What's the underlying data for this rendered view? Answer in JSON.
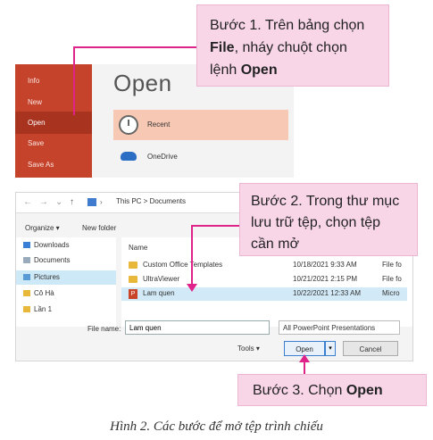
{
  "backstage": {
    "menu": [
      "Info",
      "New",
      "Open",
      "Save",
      "Save As"
    ],
    "title": "Open",
    "recent_label": "Recent",
    "onedrive_label": "OneDrive"
  },
  "callout1": {
    "prefix": "Bước 1. Trên bảng chọn ",
    "b1": "File",
    "mid": ", nháy chuột chọn lệnh ",
    "b2": "Open"
  },
  "dialog": {
    "address": "This PC  >  Documents",
    "organize": "Organize ▾",
    "new_folder": "New folder",
    "nav_items": [
      "Downloads",
      "Documents",
      "Pictures",
      "Cô Hà",
      "Lần 1"
    ],
    "col_name": "Name",
    "files": [
      {
        "name": "Custom Office Templates",
        "date": "10/18/2021 9:33 AM",
        "type": "File fo"
      },
      {
        "name": "UltraViewer",
        "date": "10/21/2021 2:15 PM",
        "type": "File fo"
      },
      {
        "name": "Lam quen",
        "date": "10/22/2021 12:33 AM",
        "type": "Micro"
      }
    ],
    "file_name_label": "File name:",
    "file_name_value": "Lam quen",
    "file_type": "All PowerPoint Presentations",
    "tools": "Tools ▾",
    "open": "Open",
    "cancel": "Cancel"
  },
  "callout2": "Bước 2. Trong thư mục lưu trữ tệp, chọn tệp cần mở",
  "callout3": {
    "prefix": "Bước 3. Chọn ",
    "bold": "Open"
  },
  "caption": "Hình 2. Các bước để mở tệp trình chiếu"
}
